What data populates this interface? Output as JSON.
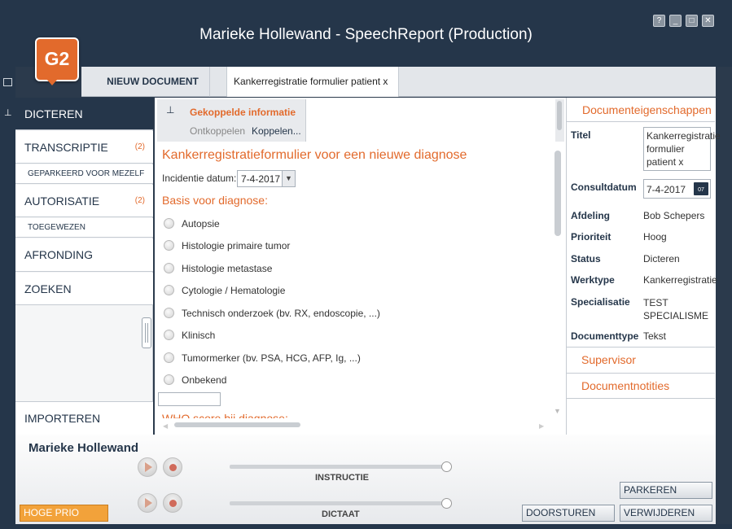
{
  "window": {
    "title": "Marieke Hollewand - SpeechReport (Production)",
    "logo_text": "G2",
    "controls": [
      "?",
      "_",
      "□",
      "✕"
    ]
  },
  "tabs": {
    "new_document": "NIEUW DOCUMENT",
    "active_document": "Kankerregistratie formulier patient x"
  },
  "nav": {
    "dicteren": "DICTEREN",
    "transcriptie": "TRANSCRIPTIE",
    "transcriptie_count": "(2)",
    "geparkeerd": "GEPARKEERD VOOR MEZELF",
    "autorisatie": "AUTORISATIE",
    "autorisatie_count": "(2)",
    "toegewezen": "TOEGEWEZEN",
    "afronding": "AFRONDING",
    "zoeken": "ZOEKEN",
    "importeren": "IMPORTEREN"
  },
  "linked": {
    "title": "Gekoppelde informatie",
    "unlink": "Ontkoppelen",
    "link": "Koppelen..."
  },
  "form": {
    "heading": "Kankerregistratieformulier voor een nieuwe diagnose",
    "incidence_label": "Incidentie datum:",
    "incidence_value": "7-4-2017",
    "basis_heading": "Basis voor diagnose:",
    "options": [
      "Autopsie",
      "Histologie primaire tumor",
      "Histologie metastase",
      "Cytologie / Hematologie",
      "Technisch onderzoek (bv. RX, endoscopie, ...)",
      "Klinisch",
      "Tumormerker (bv. PSA, HCG, AFP, Ig, ...)",
      "Onbekend"
    ],
    "who_heading": "WHO score bij diagnose:"
  },
  "properties": {
    "header": "Documenteigenschappen",
    "titel_label": "Titel",
    "titel_value": "Kankerregistratie formulier patient x",
    "consult_label": "Consultdatum",
    "consult_value": "7-4-2017",
    "calendar_day": "07",
    "afdeling_label": "Afdeling",
    "afdeling_value": "Bob Schepers",
    "prioriteit_label": "Prioriteit",
    "prioriteit_value": "Hoog",
    "status_label": "Status",
    "status_value": "Dicteren",
    "werktype_label": "Werktype",
    "werktype_value": "Kankerregistratie",
    "specialisatie_label": "Specialisatie",
    "specialisatie_value": "TEST SPECIALISME",
    "documenttype_label": "Documenttype",
    "documenttype_value": "Tekst",
    "supervisor": "Supervisor",
    "notities": "Documentnotities"
  },
  "bottom": {
    "user": "Marieke Hollewand",
    "instructie": "INSTRUCTIE",
    "dictaat": "DICTAAT",
    "hoge_prio": "HOGE PRIO",
    "parkeren": "PARKEREN",
    "doorsturen": "DOORSTUREN",
    "verwijderen": "VERWIJDEREN"
  },
  "colors": {
    "accent": "#e26a2c",
    "navy": "#25364a"
  }
}
